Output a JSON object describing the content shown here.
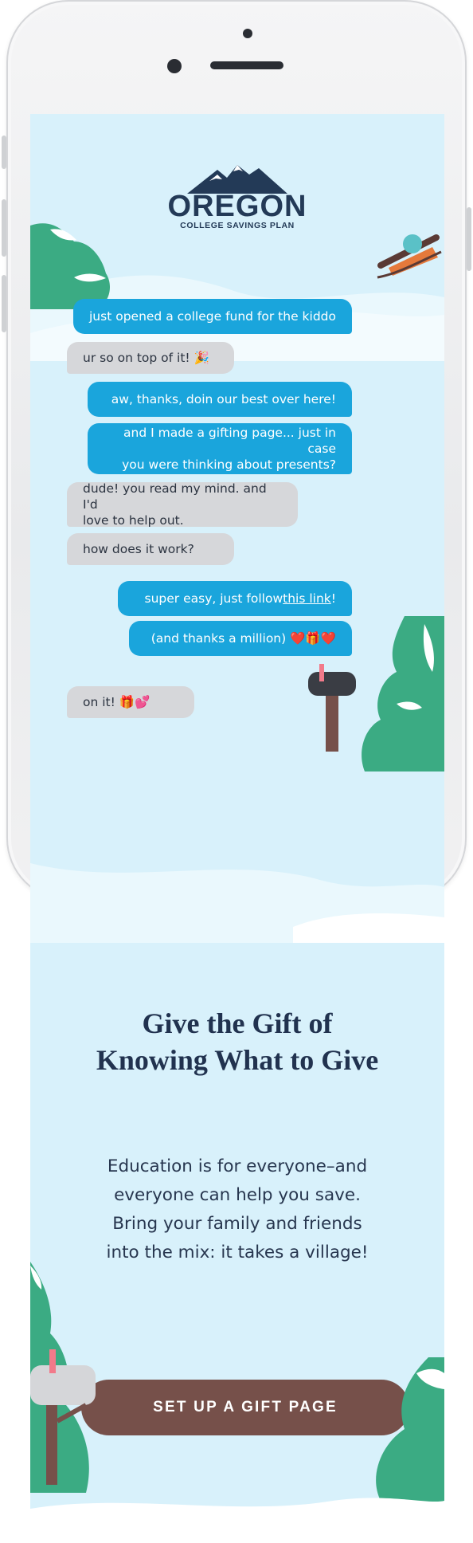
{
  "brand": {
    "name": "OREGON",
    "tagline": "COLLEGE SAVINGS PLAN"
  },
  "conversation": [
    {
      "from": "me",
      "text": "just opened a college fund for the kiddo"
    },
    {
      "from": "them",
      "text": "ur so on top of it! 🎉"
    },
    {
      "from": "me",
      "text": "aw, thanks, doin our best over here!"
    },
    {
      "from": "me",
      "line1": "and I made a gifting page... just in case",
      "line2": "you were thinking about presents?"
    },
    {
      "from": "them",
      "line1": "dude! you read my mind. and I'd",
      "line2": "love to help out."
    },
    {
      "from": "them",
      "text": "how does it work?"
    },
    {
      "from": "me",
      "prefix": "super easy, just follow ",
      "link": "this link",
      "suffix": "!"
    },
    {
      "from": "me",
      "text": "(and thanks a million) ❤️🎁❤️"
    },
    {
      "from": "them",
      "text": "on it! 🎁💕"
    }
  ],
  "headline": {
    "line1": "Give the Gift of",
    "line2": "Knowing What to Give"
  },
  "body": {
    "line1": "Education is for everyone–and",
    "line2": "everyone can help you save.",
    "line3": "Bring your family and friends",
    "line4": "into the mix: it takes a village!"
  },
  "cta": {
    "label": "SET UP A GIFT PAGE"
  },
  "colors": {
    "sky": "#d8f1fb",
    "bubble_me": "#1aa5dc",
    "bubble_them": "#d6d7da",
    "headline": "#21324f",
    "cta": "#76504a",
    "tree": "#3bab83"
  },
  "icons": [
    "mountain-logo-icon",
    "sled-icon",
    "mailbox-icon",
    "tree-icon"
  ]
}
